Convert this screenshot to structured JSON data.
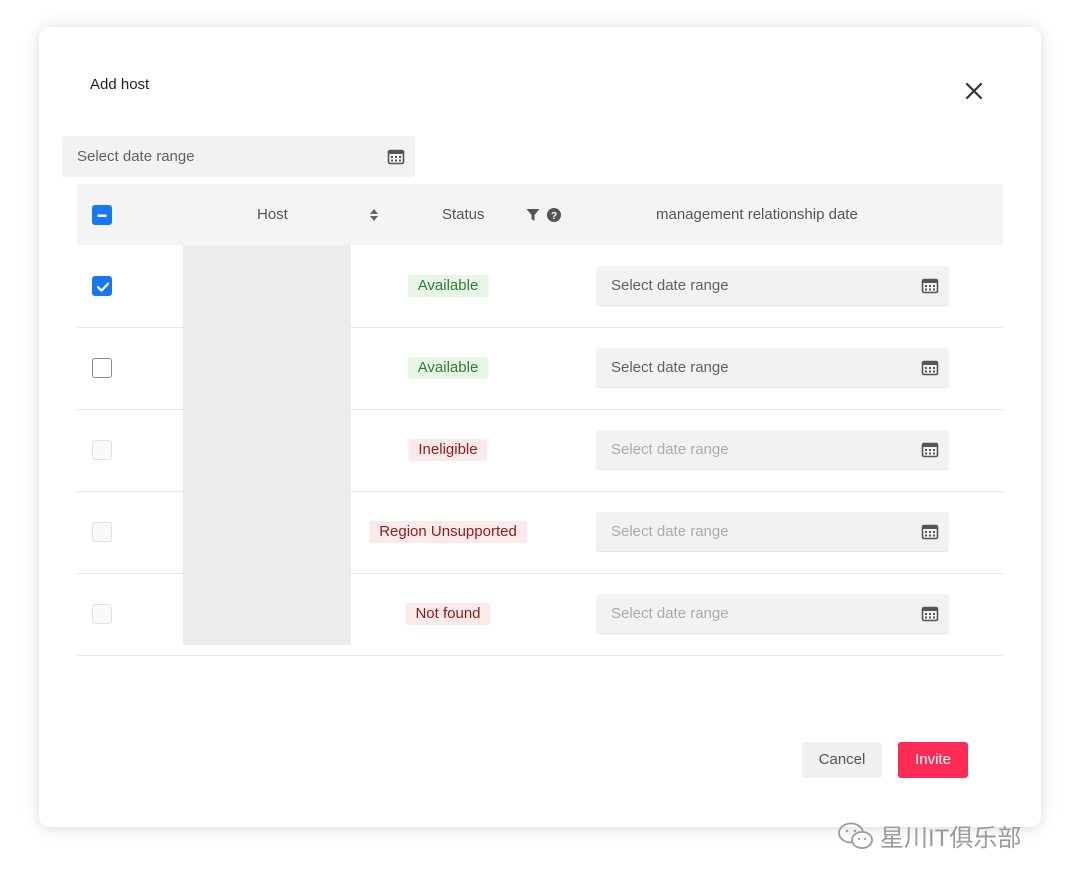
{
  "dialog": {
    "title": "Add host",
    "date_range_placeholder": "Select date range"
  },
  "table": {
    "headers": {
      "host": "Host",
      "status": "Status",
      "date": "management relationship date"
    },
    "rows": [
      {
        "checked": true,
        "disabled": false,
        "status": "Available",
        "status_type": "ok",
        "date_placeholder": "Select date range"
      },
      {
        "checked": false,
        "disabled": false,
        "status": "Available",
        "status_type": "ok",
        "date_placeholder": "Select date range"
      },
      {
        "checked": false,
        "disabled": true,
        "status": "Ineligible",
        "status_type": "bad",
        "date_placeholder": "Select date range"
      },
      {
        "checked": false,
        "disabled": true,
        "status": "Region  Unsupported",
        "status_type": "bad",
        "date_placeholder": "Select date range"
      },
      {
        "checked": false,
        "disabled": true,
        "status": "Not found",
        "status_type": "bad",
        "date_placeholder": "Select date range"
      }
    ]
  },
  "footer": {
    "cancel_label": "Cancel",
    "invite_label": "Invite"
  },
  "watermark": {
    "text": "星川IT俱乐部"
  },
  "colors": {
    "primary": "#fe2c55",
    "checkbox": "#1877f2",
    "status_ok_text": "#2f7d32",
    "status_ok_bg": "#e8f5e6",
    "status_bad_text": "#8b1c1c",
    "status_bad_bg": "#fbeaea"
  },
  "icons": [
    "close-icon",
    "calendar-icon",
    "sort-icon",
    "filter-icon",
    "help-icon",
    "check-icon",
    "wechat-icon"
  ]
}
